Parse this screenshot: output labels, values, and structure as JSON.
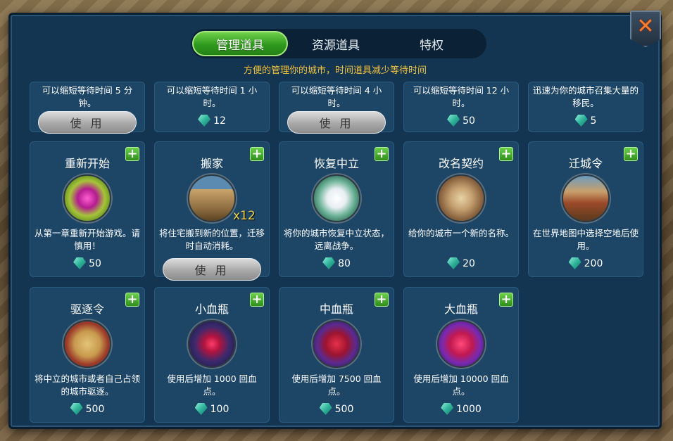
{
  "tabs": [
    {
      "label": "管理道具",
      "active": true
    },
    {
      "label": "资源道具",
      "active": false
    },
    {
      "label": "特权",
      "active": false
    }
  ],
  "subtitle": "方便的管理你的城市，时间道具减少等待时间",
  "close_label": "✕",
  "use_label": "使 用",
  "top_row": [
    {
      "desc": "可以缩短等待时间 5 分钟。",
      "price": null,
      "button": true
    },
    {
      "desc": "可以缩短等待时间 1 小时。",
      "price": "12",
      "button": false
    },
    {
      "desc": "可以缩短等待时间 4 小时。",
      "price": null,
      "button": true
    },
    {
      "desc": "可以缩短等待时间 12 小时。",
      "price": "50",
      "button": false
    },
    {
      "desc": "迅速为你的城市召集大量的移民。",
      "price": "5",
      "button": false
    }
  ],
  "row2": [
    {
      "name": "重新开始",
      "desc": "从第一章重新开始游戏。请慎用！",
      "price": "50",
      "icon": "restart-icon"
    },
    {
      "name": "搬家",
      "desc": "将住宅搬到新的位置，迁移时自动消耗。",
      "qty": "x12",
      "icon": "house-raft-icon"
    },
    {
      "name": "恢复中立",
      "desc": "将你的城市恢复中立状态，远离战争。",
      "price": "80",
      "icon": "dove-icon"
    },
    {
      "name": "改名契约",
      "desc": "给你的城市一个新的名称。",
      "price": "20",
      "icon": "scroll-quill-icon"
    },
    {
      "name": "迁城令",
      "desc": "在世界地图中选择空地后使用。",
      "price": "200",
      "icon": "wagon-icon"
    }
  ],
  "row3": [
    {
      "name": "驱逐令",
      "desc": "将中立的城市或者自己占领的城市驱逐。",
      "price": "500",
      "icon": "map-sword-icon"
    },
    {
      "name": "小血瓶",
      "desc": "使用后增加 1000 回血点。",
      "price": "100",
      "icon": "small-potion-icon"
    },
    {
      "name": "中血瓶",
      "desc": "使用后增加 7500 回血点。",
      "price": "500",
      "icon": "medium-potion-icon"
    },
    {
      "name": "大血瓶",
      "desc": "使用后增加 10000 回血点。",
      "price": "1000",
      "icon": "large-potion-icon"
    }
  ],
  "colors": {
    "accent_green": "#2f9a1e",
    "subtitle_gold": "#f3c33c",
    "panel": "#143551",
    "card": "#1d4566"
  }
}
